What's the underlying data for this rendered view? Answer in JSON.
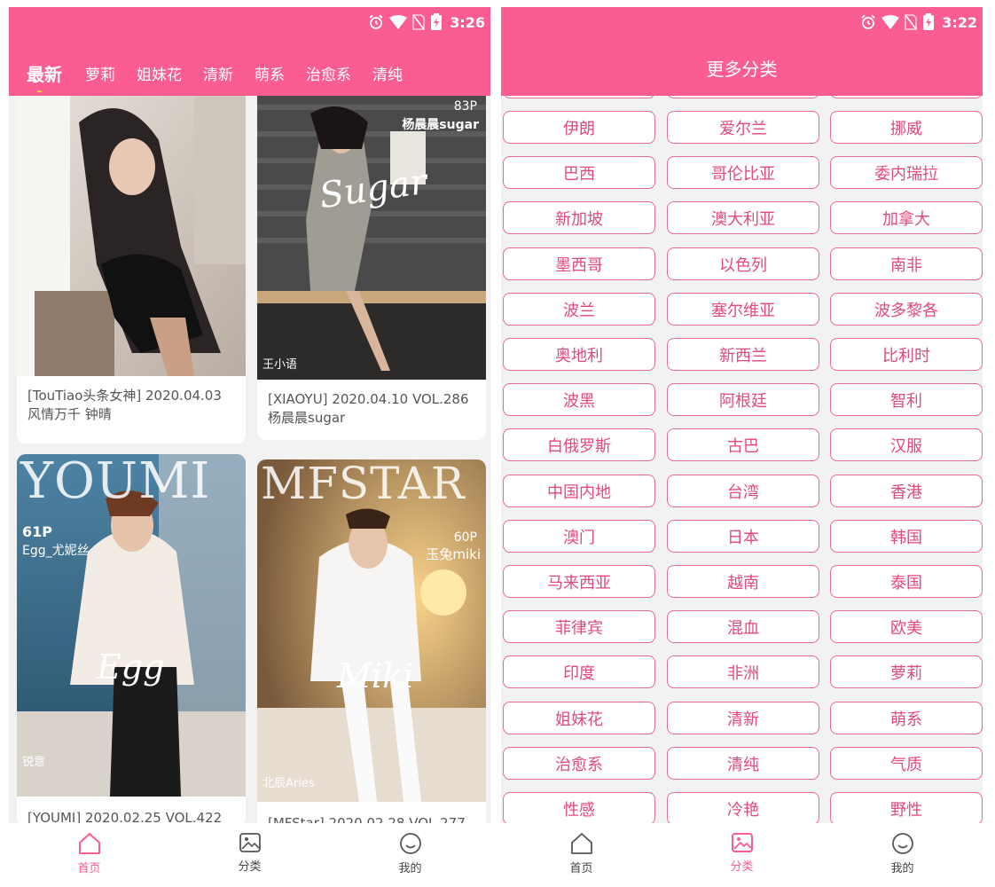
{
  "left": {
    "status_time": "3:26",
    "tabs": [
      "最新",
      "萝莉",
      "姐妹花",
      "清新",
      "萌系",
      "治愈系",
      "清纯"
    ],
    "cards": [
      {
        "caption": "[TouTiao头条女神] 2020.04.03 风情万千 钟晴",
        "overlay_brand": "",
        "overlay_count": "",
        "overlay_model": "",
        "overlay_signature": "",
        "overlay_photographer": ""
      },
      {
        "caption": "[XIAOYU] 2020.04.10 VOL.286 杨晨晨sugar",
        "overlay_brand": "",
        "overlay_count": "83P",
        "overlay_model": "杨晨晨sugar",
        "overlay_signature": "Sugar",
        "overlay_photographer": "王小语"
      },
      {
        "caption": "[YOUMI] 2020.02.25 VOL.422",
        "overlay_brand": "YOUMI",
        "overlay_count": "61P",
        "overlay_model": "Egg_尤妮丝",
        "overlay_signature": "Egg",
        "overlay_photographer": "锐意"
      },
      {
        "caption": "[MFStar] 2020.02.28 VOL.277",
        "overlay_brand": "MFSTAR",
        "overlay_count": "60P",
        "overlay_model": "玉兔miki",
        "overlay_signature": "Miki",
        "overlay_photographer": "北辰Aries"
      }
    ],
    "nav": [
      "首页",
      "分类",
      "我的"
    ]
  },
  "right": {
    "status_time": "3:22",
    "title": "更多分类",
    "categories": [
      "伊朗",
      "爱尔兰",
      "挪威",
      "巴西",
      "哥伦比亚",
      "委内瑞拉",
      "新加坡",
      "澳大利亚",
      "加拿大",
      "墨西哥",
      "以色列",
      "南非",
      "波兰",
      "塞尔维亚",
      "波多黎各",
      "奥地利",
      "新西兰",
      "比利时",
      "波黑",
      "阿根廷",
      "智利",
      "白俄罗斯",
      "古巴",
      "汉服",
      "中国内地",
      "台湾",
      "香港",
      "澳门",
      "日本",
      "韩国",
      "马来西亚",
      "越南",
      "泰国",
      "菲律宾",
      "混血",
      "欧美",
      "印度",
      "非洲",
      "萝莉",
      "姐妹花",
      "清新",
      "萌系",
      "治愈系",
      "清纯",
      "气质",
      "性感",
      "冷艳",
      "野性"
    ],
    "nav": [
      "首页",
      "分类",
      "我的"
    ]
  },
  "colors": {
    "brand": "#fb5d91",
    "category_text": "#e4487a",
    "category_border": "#e86a8d",
    "tab_indicator": "#ffd44a"
  }
}
